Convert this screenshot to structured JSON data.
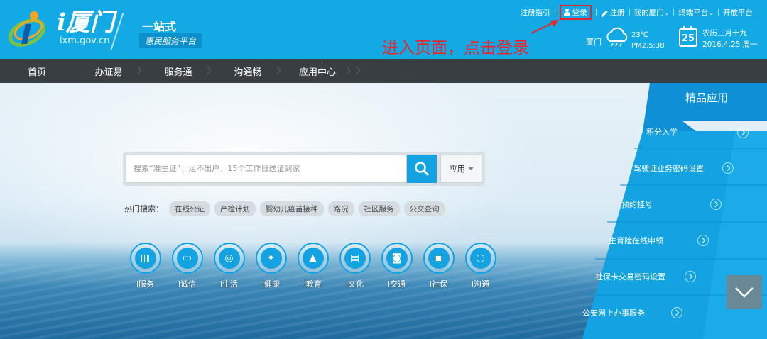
{
  "brand": {
    "name": "i厦门",
    "domain": "ixm.gov.cn",
    "slogan_main": "一站式",
    "slogan_sub": "惠民服务平台"
  },
  "topnav": {
    "register_guide": "注册指引",
    "login": "登录",
    "register": "注册",
    "my_xiamen": "我的厦门",
    "terminal": "终端平台",
    "open_platform": "开放平台"
  },
  "annotation": "进入页面，点击登录",
  "weather": {
    "city": "厦门",
    "temp": "23℃",
    "pm": "PM2.5:38"
  },
  "calendar": {
    "day": "25",
    "lunar": "农历三月十九",
    "date": "2016.4.25 周一"
  },
  "mainnav": [
    "首页",
    "办证易",
    "服务通",
    "沟通畅",
    "应用中心"
  ],
  "search": {
    "placeholder": "搜索“准生证”，足不出户，15个工作日送证到家",
    "select_label": "应用"
  },
  "hot": {
    "label": "热门搜索：",
    "tags": [
      "在线公证",
      "产检计划",
      "婴幼儿疫苗接种",
      "路况",
      "社区服务",
      "公交查询"
    ]
  },
  "categories": [
    {
      "label": "i服务",
      "icon": "books-icon"
    },
    {
      "label": "i诚信",
      "icon": "card-icon"
    },
    {
      "label": "i生活",
      "icon": "camera-icon"
    },
    {
      "label": "i健康",
      "icon": "fitness-icon"
    },
    {
      "label": "i教育",
      "icon": "graduation-cap-icon"
    },
    {
      "label": "i文化",
      "icon": "book-icon"
    },
    {
      "label": "i交通",
      "icon": "car-icon"
    },
    {
      "label": "i社保",
      "icon": "insurance-icon"
    },
    {
      "label": "i沟通",
      "icon": "chat-icon"
    }
  ],
  "apps": {
    "title": "精品应用",
    "items": [
      "积分入学",
      "驾驶证业务密码设置",
      "预约挂号",
      "生育险在线申领",
      "社保卡交易密码设置",
      "公安网上办事服务"
    ]
  },
  "colors": {
    "header": "#13a9e4",
    "nav": "#393e42",
    "accent": "#14a3e2",
    "annotation": "#e8262a"
  }
}
